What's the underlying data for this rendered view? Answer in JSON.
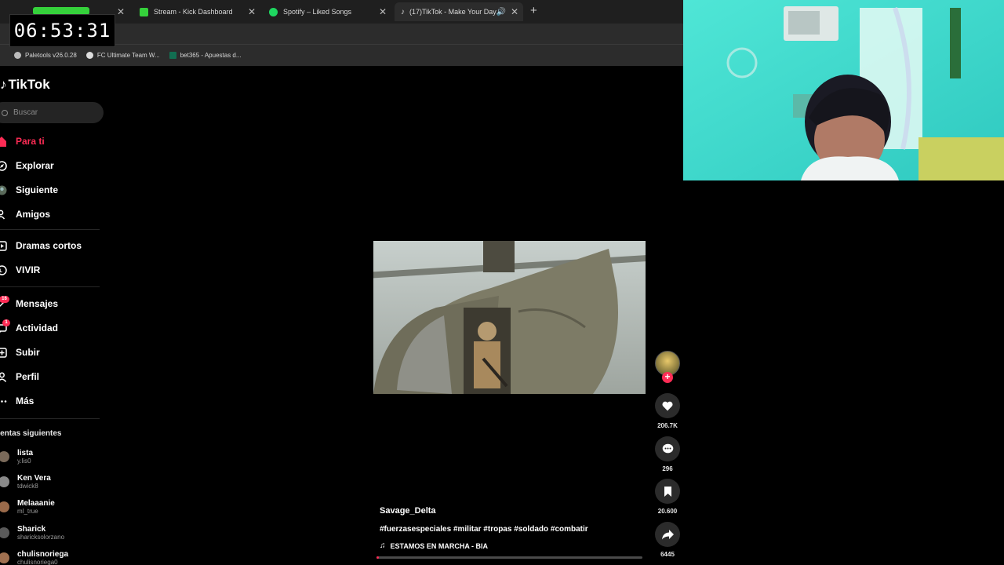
{
  "browser": {
    "tabs": [
      {
        "label": "",
        "icon": "kick-icon",
        "active": false
      },
      {
        "label": "Stream - Kick Dashboard",
        "icon": "kick-icon",
        "active": false
      },
      {
        "label": "Spotify – Liked Songs",
        "icon": "spotify-icon",
        "active": false
      },
      {
        "label": "(17)TikTok - Make Your Day",
        "icon": "tiktok-icon",
        "active": true
      }
    ],
    "bookmarks": [
      "Paletools v26.0.28",
      "FC Ultimate Team W...",
      "bet365 - Apuestas d..."
    ]
  },
  "overlay": {
    "timer": "06:53:31"
  },
  "sidebar": {
    "logo": "TikTok",
    "search_placeholder": "Buscar",
    "nav": [
      {
        "label": "Para ti",
        "icon": "home-icon",
        "active": true
      },
      {
        "label": "Explorar",
        "icon": "compass-icon"
      },
      {
        "label": "Siguiente",
        "icon": "following-icon"
      },
      {
        "label": "Amigos",
        "icon": "friends-icon"
      },
      {
        "label": "Dramas cortos",
        "icon": "drama-icon"
      },
      {
        "label": "VIVIR",
        "icon": "live-icon"
      },
      {
        "label": "Mensajes",
        "icon": "messages-icon",
        "badge": "16"
      },
      {
        "label": "Actividad",
        "icon": "activity-icon",
        "badge": "1"
      },
      {
        "label": "Subir",
        "icon": "upload-icon"
      },
      {
        "label": "Perfil",
        "icon": "profile-icon"
      },
      {
        "label": "Más",
        "icon": "more-icon"
      }
    ],
    "following_title": "uentas siguientes",
    "accounts": [
      {
        "name": "lista",
        "user": "y.lis0"
      },
      {
        "name": "Ken Vera",
        "user": "tdwick8"
      },
      {
        "name": "Melaaanie",
        "user": "ml_true"
      },
      {
        "name": "Sharick",
        "user": "sharicksolorzano"
      },
      {
        "name": "chulisnoriega",
        "user": "chulisnoriega0"
      }
    ]
  },
  "video": {
    "author": "Savage_Delta",
    "hashtags": "#fuerzasespeciales #militar #tropas #soldado #combatir",
    "music": "ESTAMOS EN MARCHA - BIA",
    "progress": 0.01,
    "likes": "206.7K",
    "comments": "296",
    "saves": "20.600",
    "shares": "6445"
  },
  "colors": {
    "accent": "#fe2c55",
    "background": "#000000",
    "kick_green": "#35d13b",
    "spotify_green": "#1ed760"
  }
}
